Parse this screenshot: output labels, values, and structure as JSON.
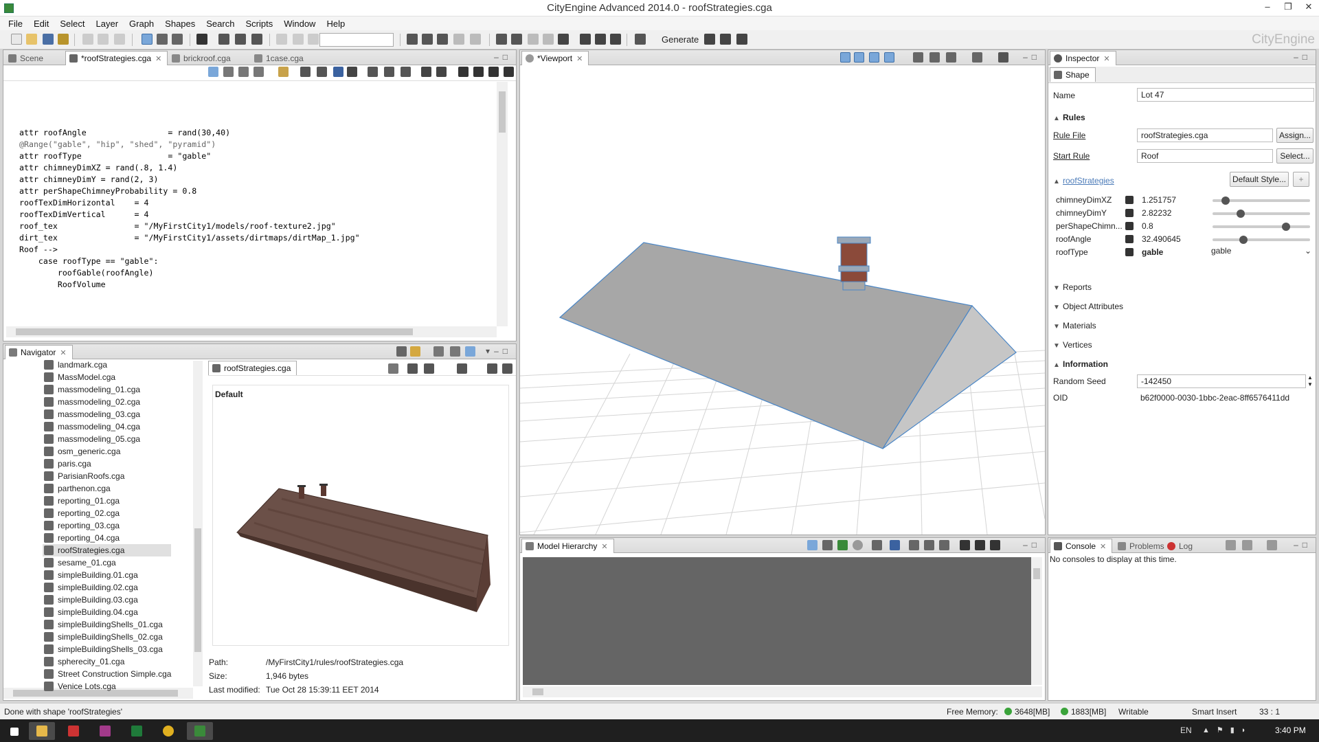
{
  "window": {
    "title": "CityEngine Advanced 2014.0 - roofStrategies.cga",
    "brand": "CityEngine",
    "min": "–",
    "max": "❐",
    "close": "✕"
  },
  "menu": [
    "File",
    "Edit",
    "Select",
    "Layer",
    "Graph",
    "Shapes",
    "Search",
    "Scripts",
    "Window",
    "Help"
  ],
  "toolbar": {
    "generate_label": "Generate"
  },
  "editor": {
    "tabs": [
      {
        "label": "Scene",
        "active": false
      },
      {
        "label": "*roofStrategies.cga",
        "active": true
      },
      {
        "label": "brickroof.cga",
        "active": false
      },
      {
        "label": "1case.cga",
        "active": false
      }
    ],
    "lines": [
      "attr roofAngle                 = rand(30,40)",
      "@Range(\"gable\", \"hip\", \"shed\", \"pyramid\")",
      "attr roofType                  = \"gable\"",
      "attr chimneyDimXZ = rand(.8, 1.4)",
      "attr chimneyDimY = rand(2, 3)",
      "attr perShapeChimneyProbability = 0.8",
      "",
      "roofTexDimHorizontal    = 4",
      "roofTexDimVertical      = 4",
      "",
      "roof_tex                = \"/MyFirstCity1/models/roof-texture2.jpg\"",
      "dirt_tex                = \"/MyFirstCity1/assets/dirtmaps/dirtMap_1.jpg\"",
      "",
      "",
      "Roof -->",
      "    case roofType == \"gable\":",
      "        roofGable(roofAngle)",
      "        RoofVolume"
    ]
  },
  "navigator": {
    "title": "Navigator",
    "items": [
      "landmark.cga",
      "MassModel.cga",
      "massmodeling_01.cga",
      "massmodeling_02.cga",
      "massmodeling_03.cga",
      "massmodeling_04.cga",
      "massmodeling_05.cga",
      "osm_generic.cga",
      "paris.cga",
      "ParisianRoofs.cga",
      "parthenon.cga",
      "reporting_01.cga",
      "reporting_02.cga",
      "reporting_03.cga",
      "reporting_04.cga",
      "roofStrategies.cga",
      "sesame_01.cga",
      "simpleBuilding.01.cga",
      "simpleBuilding.02.cga",
      "simpleBuilding.03.cga",
      "simpleBuilding.04.cga",
      "simpleBuildingShells_01.cga",
      "simpleBuildingShells_02.cga",
      "simpleBuildingShells_03.cga",
      "spherecity_01.cga",
      "Street Construction Simple.cga",
      "Venice Lots.cga"
    ],
    "selected_index": 15,
    "preview_tab": "roofStrategies.cga",
    "preview_style": "Default",
    "path_label": "Path:",
    "path": "/MyFirstCity1/rules/roofStrategies.cga",
    "size_label": "Size:",
    "size": "1,946 bytes",
    "modified_label": "Last modified:",
    "modified": "Tue Oct 28 15:39:11 EET 2014"
  },
  "viewport": {
    "tab": "*Viewport"
  },
  "model_hierarchy": {
    "tab": "Model Hierarchy"
  },
  "inspector": {
    "tab": "Inspector",
    "shape_tab": "Shape",
    "name_label": "Name",
    "name": "Lot 47",
    "rules_section": "Rules",
    "rule_file_label": "Rule File",
    "rule_file": "roofStrategies.cga",
    "assign_btn": "Assign...",
    "start_rule_label": "Start Rule",
    "start_rule": "Roof",
    "select_btn": "Select...",
    "rule_name": "roofStrategies",
    "style_btn": "Default Style...",
    "plus_btn": "+",
    "attributes": [
      {
        "name": "chimneyDimXZ",
        "value": "1.251757",
        "slider": 0.1
      },
      {
        "name": "chimneyDimY",
        "value": "2.82232",
        "slider": 0.27
      },
      {
        "name": "perShapeChimn...",
        "value": "0.8",
        "slider": 0.78
      },
      {
        "name": "roofAngle",
        "value": "32.490645",
        "slider": 0.3
      }
    ],
    "roof_type_label": "roofType",
    "roof_type_value": "gable",
    "roof_type_select": "gable",
    "sections": [
      "Reports",
      "Object Attributes",
      "Materials",
      "Vertices"
    ],
    "info_section": "Information",
    "seed_label": "Random Seed",
    "seed": "-142450",
    "oid_label": "OID",
    "oid": "b62f0000-0030-1bbc-2eac-8ff6576411dd"
  },
  "console": {
    "tabs": [
      "Console",
      "Problems",
      "Log"
    ],
    "message": "No consoles to display at this time."
  },
  "status": {
    "left": "Done with shape 'roofStrategies'",
    "free_memory_label": "Free Memory:",
    "mem1": "3648[MB]",
    "mem2": "1883[MB]",
    "writable": "Writable",
    "insert": "Smart Insert",
    "pos": "33 : 1"
  },
  "taskbar": {
    "lang": "EN",
    "time": "3:40 PM"
  }
}
